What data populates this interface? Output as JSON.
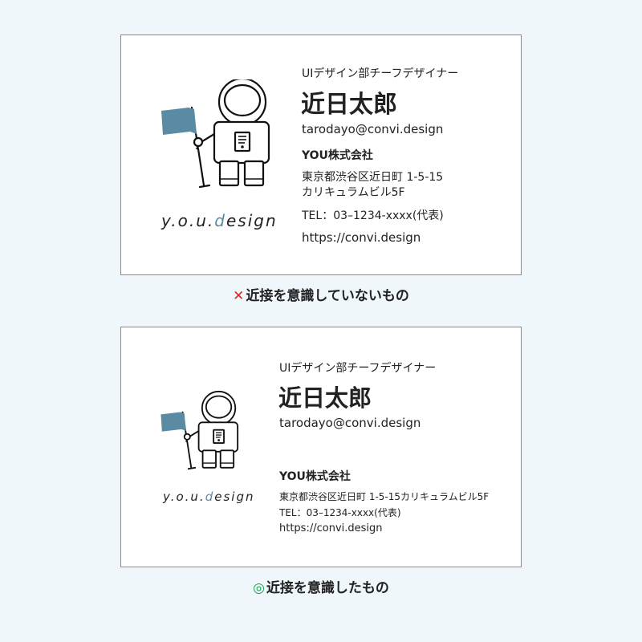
{
  "logo": {
    "prefix": "y.o.u.",
    "accent": "d",
    "suffix": "esign"
  },
  "card": {
    "role": "UIデザイン部チーフデザイナー",
    "name": "近日太郎",
    "email": "tarodayo@convi.design",
    "company": "YOU株式会社",
    "address_line1": "東京都渋谷区近日町 1-5-15",
    "address_line2": "カリキュラムビル5F",
    "address_full": "東京都渋谷区近日町 1-5-15カリキュラムビル5F",
    "tel": "TEL：03–1234-xxxx(代表)",
    "url": "https://convi.design"
  },
  "captions": {
    "bad_mark": "✕",
    "bad": "近接を意識していないもの",
    "good_mark": "◎",
    "good": "近接を意識したもの"
  },
  "colors": {
    "background": "#eff7fb",
    "flag": "#5b8ba3",
    "bad_mark": "#e02424",
    "good_mark": "#16a34a"
  },
  "icons": [
    "astronaut-with-flag-icon"
  ]
}
